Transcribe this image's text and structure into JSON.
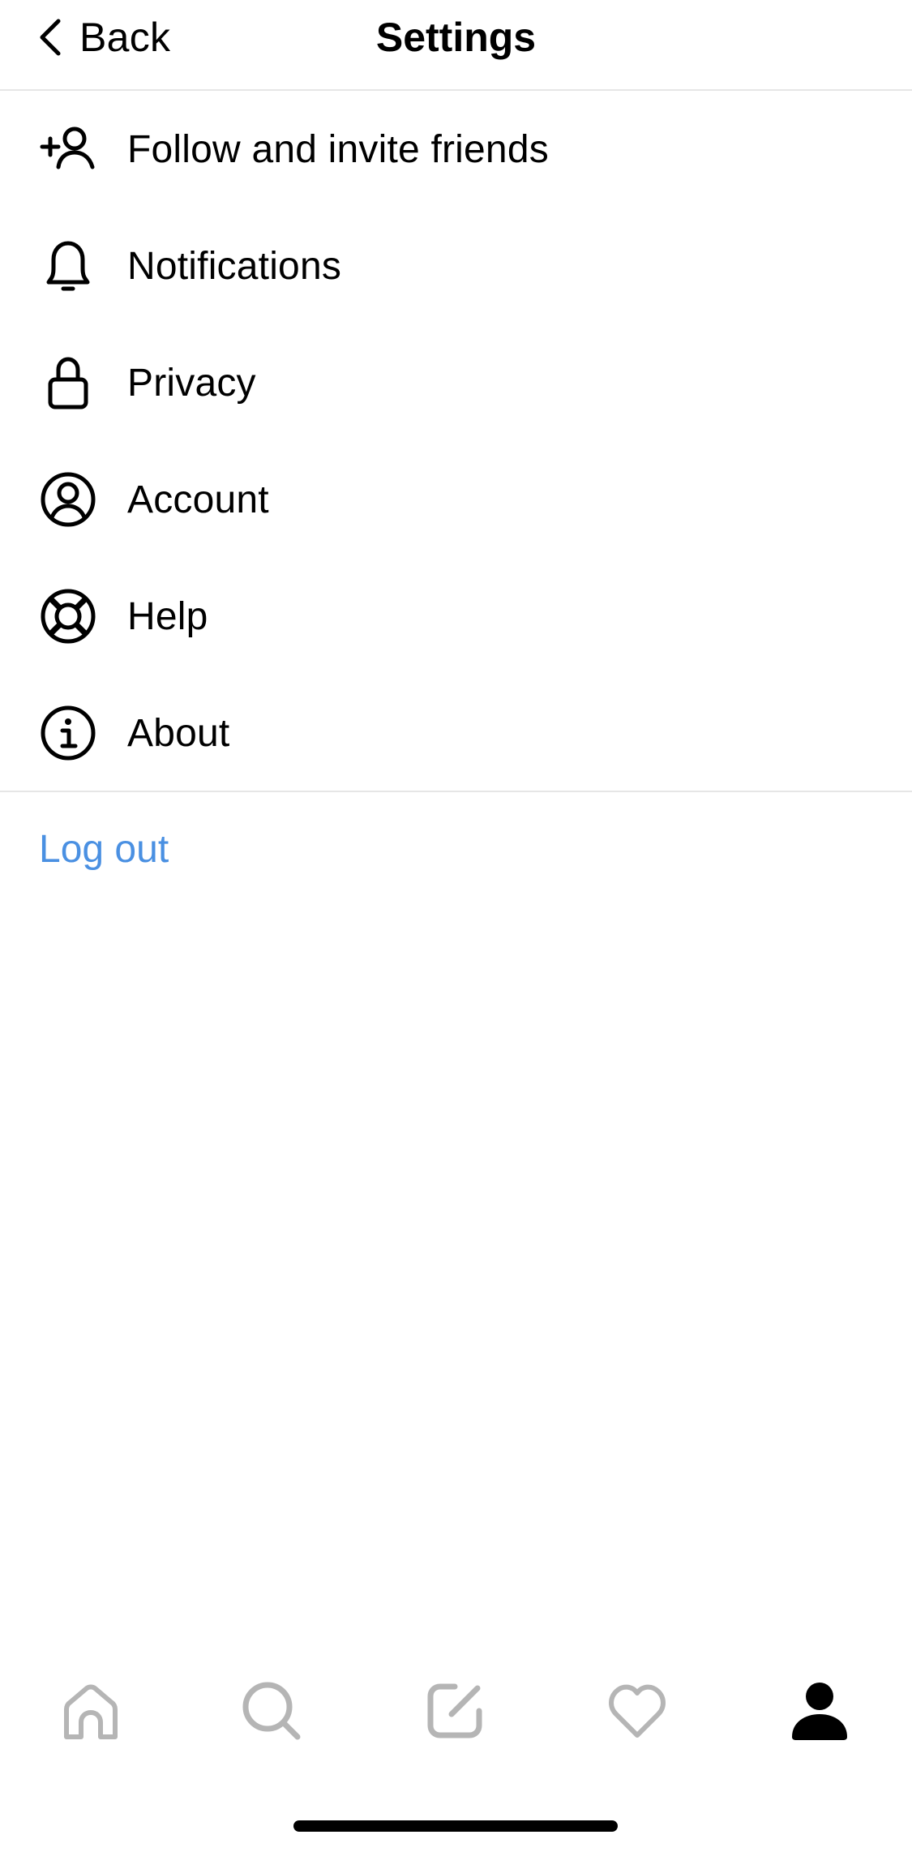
{
  "header": {
    "back_label": "Back",
    "title": "Settings"
  },
  "menu": {
    "items": [
      {
        "label": "Follow and invite friends",
        "icon": "add-person-icon"
      },
      {
        "label": "Notifications",
        "icon": "bell-icon"
      },
      {
        "label": "Privacy",
        "icon": "lock-icon"
      },
      {
        "label": "Account",
        "icon": "account-circle-icon"
      },
      {
        "label": "Help",
        "icon": "lifebuoy-icon"
      },
      {
        "label": "About",
        "icon": "info-icon"
      }
    ]
  },
  "logout_label": "Log out",
  "tabbar": {
    "tabs": [
      {
        "name": "home",
        "icon": "home-icon",
        "active": false
      },
      {
        "name": "search",
        "icon": "search-icon",
        "active": false
      },
      {
        "name": "compose",
        "icon": "compose-icon",
        "active": false
      },
      {
        "name": "activity",
        "icon": "heart-icon",
        "active": false
      },
      {
        "name": "profile",
        "icon": "person-icon",
        "active": true
      }
    ]
  },
  "colors": {
    "accent_link": "#4a90e2",
    "inactive_icon": "#b5b5b5",
    "active_icon": "#000000",
    "divider": "#e6e6e6"
  }
}
